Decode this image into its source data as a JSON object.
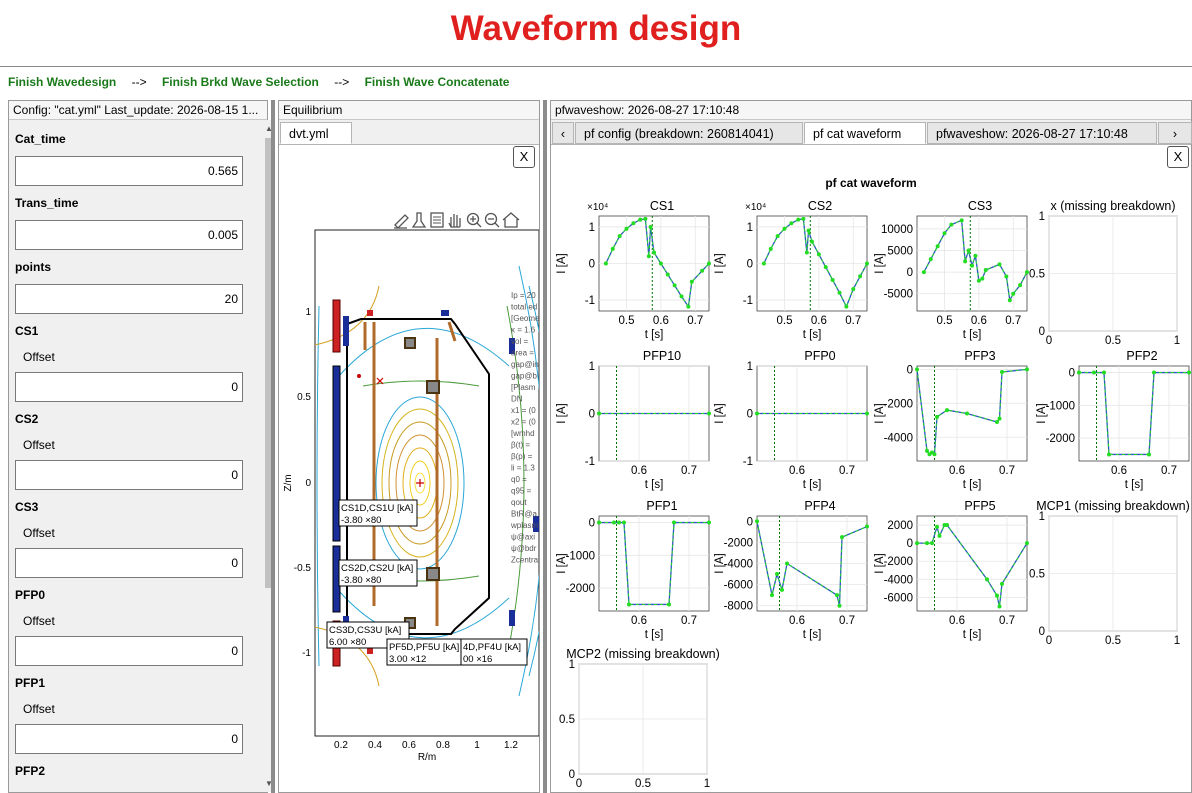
{
  "page_title": "Waveform design",
  "nav": {
    "step1": "Finish Wavedesign",
    "arrow1": "-->",
    "step2": "Finish Brkd Wave Selection",
    "arrow2": "-->",
    "step3": "Finish Wave Concatenate"
  },
  "config": {
    "header": "Config: \"cat.yml\"  Last_update: 2026-08-15 1...",
    "cat_time_label": "Cat_time",
    "cat_time_value": "0.565",
    "trans_time_label": "Trans_time",
    "trans_time_value": "0.005",
    "points_label": "points",
    "points_value": "20",
    "offset_label": "Offset",
    "coils": [
      {
        "name": "CS1",
        "offset": "0"
      },
      {
        "name": "CS2",
        "offset": "0"
      },
      {
        "name": "CS3",
        "offset": "0"
      },
      {
        "name": "PFP0",
        "offset": "0"
      },
      {
        "name": "PFP1",
        "offset": "0"
      },
      {
        "name": "PFP2",
        "offset": ""
      }
    ]
  },
  "equilibrium": {
    "header": "Equilibrium",
    "tab": "dvt.yml",
    "close": "X",
    "xlabel": "R/m",
    "ylabel": "Z/m",
    "xticks": [
      "0.2",
      "0.4",
      "0.6",
      "0.8",
      "1",
      "1.2"
    ],
    "yticks": [
      "1",
      "0.5",
      "0",
      "-0.5",
      "-1"
    ],
    "annotations": [
      {
        "l1": "CS1D,CS1U [kA]",
        "l2": "-3.80 ×80"
      },
      {
        "l1": "CS2D,CS2U [kA]",
        "l2": "-3.80 ×80"
      },
      {
        "l1": "CS3D,CS3U [kA]",
        "l2": "6.00 ×80"
      },
      {
        "l1": "PF5D,PF5U [kA]",
        "l2": "3.00 ×12"
      },
      {
        "l1": "4D,PF4U [kA]",
        "l2": "00 ×16"
      }
    ],
    "side_text": [
      "Ip = 20",
      "total ed",
      "[Geome",
      "κ = 1.6",
      "vol =",
      "area =",
      "gap@in",
      "gap@b",
      "[Plasm",
      "DN",
      "x1 = (0",
      "x2 = (0",
      "[wmhd",
      "β(t) =",
      "β(p) =",
      "li = 1.3",
      "q0 =",
      "q95 =",
      "qout",
      "BtR@a",
      "wplasm",
      "ψ@axi",
      "ψ@bdr",
      "Zcentra"
    ]
  },
  "pfwave": {
    "header": "pfwaveshow: 2026-08-27 17:10:48",
    "tabs": [
      "pf config (breakdown: 260814041)",
      "pf cat waveform",
      "pfwaveshow: 2026-08-27 17:10:48"
    ],
    "close": "X",
    "figure_title": "pf cat waveform",
    "xlabel": "t [s]",
    "ylabel": "I [A]"
  },
  "colors": {
    "title": "#e0201e",
    "nav": "#1a7a1a",
    "series": "#2e55c4",
    "points": "#22dd22",
    "vline": "#007700"
  },
  "chart_data": [
    {
      "type": "line",
      "title": "CS1",
      "exponent": "×10⁴",
      "xlim": [
        0.42,
        0.74
      ],
      "ylim": [
        -1.3,
        1.3
      ],
      "xticks": [
        0.5,
        0.6,
        0.7
      ],
      "yticks": [
        -1,
        0,
        1
      ],
      "vline": 0.575,
      "series": [
        {
          "x": [
            0.44,
            0.46,
            0.48,
            0.5,
            0.52,
            0.54,
            0.555,
            0.565,
            0.57,
            0.58,
            0.6,
            0.62,
            0.64,
            0.66,
            0.68,
            0.69,
            0.72,
            0.74
          ],
          "y": [
            0,
            0.4,
            0.75,
            0.95,
            1.1,
            1.2,
            1.22,
            0.2,
            1.0,
            0.3,
            0,
            -0.3,
            -0.6,
            -0.9,
            -1.18,
            -0.5,
            -0.2,
            0
          ]
        }
      ]
    },
    {
      "type": "line",
      "title": "CS2",
      "exponent": "×10⁴",
      "xlim": [
        0.42,
        0.74
      ],
      "ylim": [
        -1.3,
        1.3
      ],
      "xticks": [
        0.5,
        0.6,
        0.7
      ],
      "yticks": [
        -1,
        0,
        1
      ],
      "vline": 0.575,
      "series": [
        {
          "x": [
            0.44,
            0.46,
            0.48,
            0.5,
            0.52,
            0.54,
            0.555,
            0.565,
            0.57,
            0.58,
            0.6,
            0.62,
            0.64,
            0.66,
            0.68,
            0.7,
            0.72,
            0.74
          ],
          "y": [
            0,
            0.4,
            0.75,
            0.95,
            1.1,
            1.2,
            1.22,
            0.3,
            0.9,
            0.6,
            0.25,
            -0.1,
            -0.45,
            -0.8,
            -1.18,
            -0.7,
            -0.35,
            0
          ]
        }
      ]
    },
    {
      "type": "line",
      "title": "CS3",
      "xlim": [
        0.42,
        0.74
      ],
      "ylim": [
        -9000,
        13000
      ],
      "xticks": [
        0.5,
        0.6,
        0.7
      ],
      "yticks": [
        -5000,
        0,
        5000,
        10000
      ],
      "vline": 0.575,
      "series": [
        {
          "x": [
            0.44,
            0.46,
            0.48,
            0.5,
            0.52,
            0.55,
            0.56,
            0.57,
            0.58,
            0.59,
            0.6,
            0.61,
            0.62,
            0.66,
            0.68,
            0.69,
            0.7,
            0.72,
            0.74
          ],
          "y": [
            0,
            3000,
            6000,
            9000,
            11000,
            12000,
            2500,
            5000,
            1500,
            3800,
            -2000,
            -1500,
            500,
            1800,
            -1000,
            -6500,
            -5000,
            -3000,
            0
          ]
        }
      ]
    },
    {
      "type": "line",
      "title": "x (missing breakdown)",
      "xlim": [
        0,
        1
      ],
      "ylim": [
        0,
        1
      ],
      "xticks": [
        0,
        0.5,
        1
      ],
      "yticks": [
        0,
        0.5,
        1
      ],
      "series": []
    },
    {
      "type": "line",
      "title": "PFP10",
      "xlim": [
        0.52,
        0.74
      ],
      "ylim": [
        -1,
        1
      ],
      "xticks": [
        0.6,
        0.7
      ],
      "yticks": [
        -1,
        0,
        1
      ],
      "vline": 0.555,
      "series": [
        {
          "x": [
            0.52,
            0.74
          ],
          "y": [
            0,
            0
          ]
        }
      ]
    },
    {
      "type": "line",
      "title": "PFP0",
      "xlim": [
        0.52,
        0.74
      ],
      "ylim": [
        -1,
        1
      ],
      "xticks": [
        0.6,
        0.7
      ],
      "yticks": [
        -1,
        0,
        1
      ],
      "vline": 0.555,
      "series": [
        {
          "x": [
            0.52,
            0.74
          ],
          "y": [
            0,
            0
          ]
        }
      ]
    },
    {
      "type": "line",
      "title": "PFP3",
      "xlim": [
        0.52,
        0.74
      ],
      "ylim": [
        -5400,
        200
      ],
      "xticks": [
        0.6,
        0.7
      ],
      "yticks": [
        -4000,
        -2000,
        0
      ],
      "vline": 0.555,
      "series": [
        {
          "x": [
            0.52,
            0.54,
            0.545,
            0.55,
            0.555,
            0.56,
            0.58,
            0.62,
            0.68,
            0.685,
            0.69,
            0.74
          ],
          "y": [
            0,
            -4800,
            -5000,
            -4900,
            -5000,
            -2800,
            -2400,
            -2600,
            -3100,
            -2900,
            -150,
            0
          ]
        }
      ]
    },
    {
      "type": "line",
      "title": "PFP2",
      "xlim": [
        0.52,
        0.74
      ],
      "ylim": [
        -2700,
        200
      ],
      "xticks": [
        0.6,
        0.7
      ],
      "yticks": [
        -2000,
        -1000,
        0
      ],
      "vline": 0.555,
      "series": [
        {
          "x": [
            0.52,
            0.55,
            0.57,
            0.58,
            0.66,
            0.67,
            0.74
          ],
          "y": [
            0,
            0,
            0,
            -2500,
            -2500,
            0,
            0
          ]
        }
      ]
    },
    {
      "type": "line",
      "title": "PFP1",
      "xlim": [
        0.52,
        0.74
      ],
      "ylim": [
        -2700,
        200
      ],
      "xticks": [
        0.6,
        0.7
      ],
      "yticks": [
        -2000,
        -1000,
        0
      ],
      "vline": 0.555,
      "series": [
        {
          "x": [
            0.52,
            0.55,
            0.56,
            0.57,
            0.58,
            0.66,
            0.67,
            0.74
          ],
          "y": [
            0,
            0,
            0,
            0,
            -2500,
            -2500,
            0,
            0
          ]
        }
      ]
    },
    {
      "type": "line",
      "title": "PFP4",
      "xlim": [
        0.52,
        0.74
      ],
      "ylim": [
        -8500,
        500
      ],
      "xticks": [
        0.6,
        0.7
      ],
      "yticks": [
        -8000,
        -6000,
        -4000,
        -2000,
        0
      ],
      "vline": 0.565,
      "series": [
        {
          "x": [
            0.52,
            0.55,
            0.56,
            0.57,
            0.58,
            0.68,
            0.685,
            0.69,
            0.74
          ],
          "y": [
            0,
            -7000,
            -5000,
            -6500,
            -4000,
            -7000,
            -8000,
            -1500,
            -500
          ]
        }
      ]
    },
    {
      "type": "line",
      "title": "PFP5",
      "xlim": [
        0.52,
        0.74
      ],
      "ylim": [
        -7500,
        3000
      ],
      "xticks": [
        0.6,
        0.7
      ],
      "yticks": [
        -6000,
        -4000,
        -2000,
        0,
        2000
      ],
      "vline": 0.555,
      "series": [
        {
          "x": [
            0.52,
            0.54,
            0.55,
            0.56,
            0.565,
            0.575,
            0.58,
            0.66,
            0.68,
            0.685,
            0.69,
            0.74
          ],
          "y": [
            0,
            0,
            0,
            1800,
            800,
            2000,
            2000,
            -4000,
            -5800,
            -7000,
            -4500,
            0
          ]
        }
      ]
    },
    {
      "type": "line",
      "title": "MCP1 (missing breakdown)",
      "xlim": [
        0,
        1
      ],
      "ylim": [
        0,
        1
      ],
      "xticks": [
        0,
        0.5,
        1
      ],
      "yticks": [
        0,
        0.5,
        1
      ],
      "series": []
    },
    {
      "type": "line",
      "title": "MCP2 (missing breakdown)",
      "xlim": [
        0,
        1
      ],
      "ylim": [
        0,
        1
      ],
      "xticks": [
        0,
        0.5,
        1
      ],
      "yticks": [
        0,
        0.5,
        1
      ],
      "series": []
    }
  ]
}
